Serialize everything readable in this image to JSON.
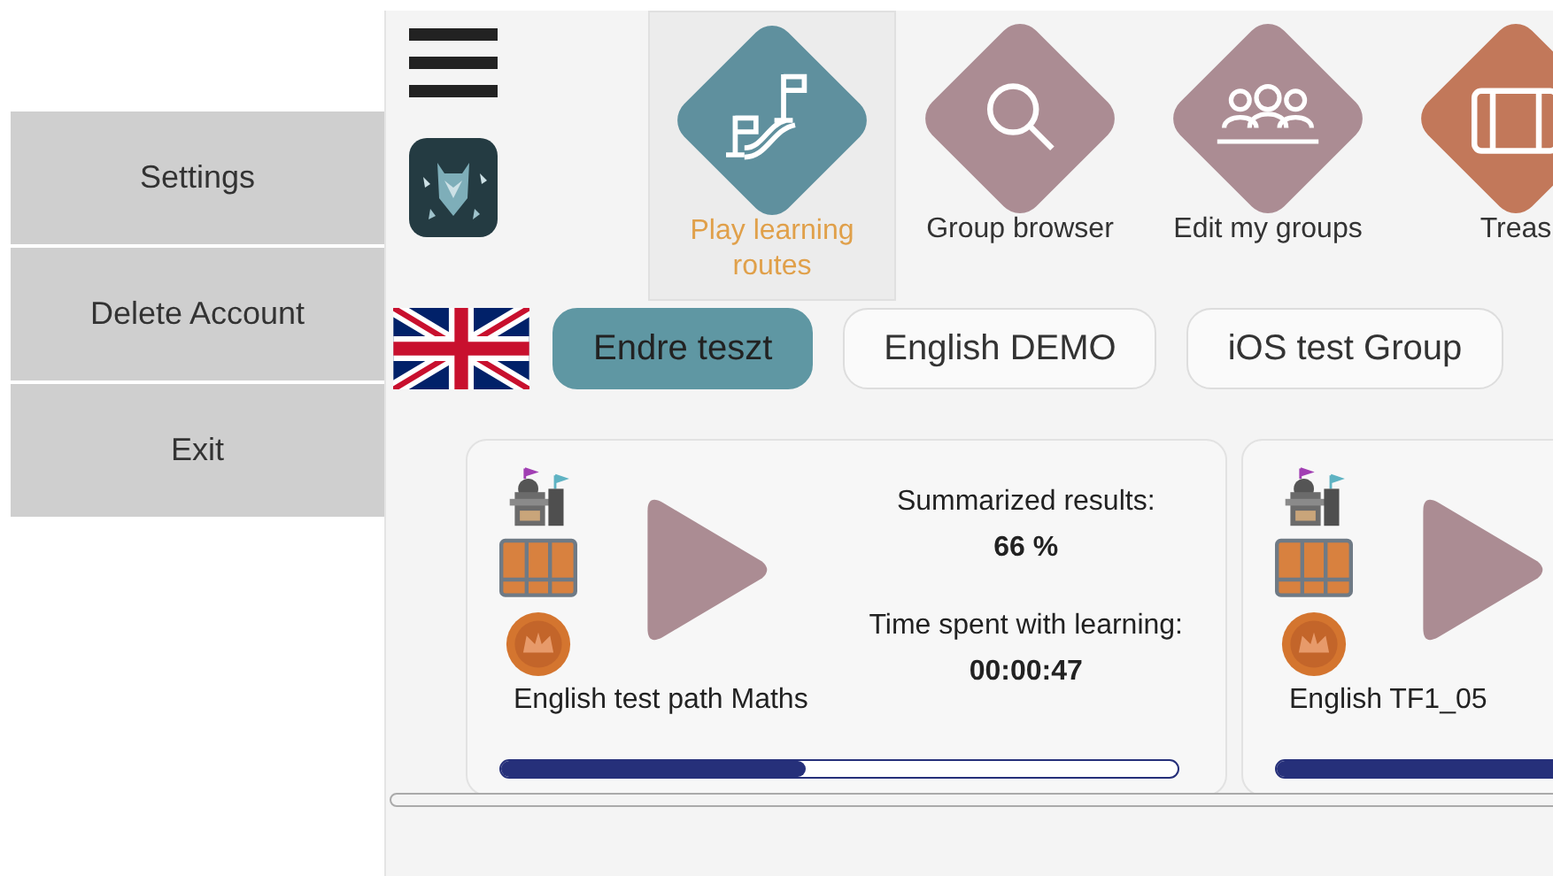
{
  "side_menu": [
    {
      "label": "Settings"
    },
    {
      "label": "Delete Account"
    },
    {
      "label": "Exit"
    }
  ],
  "nav": [
    {
      "label": "Play learning routes",
      "selected": true,
      "color": "#5f909e",
      "kind": "route"
    },
    {
      "label": "Group browser",
      "selected": false,
      "color": "#ab8c93",
      "kind": "search"
    },
    {
      "label": "Edit my groups",
      "selected": false,
      "color": "#ab8c93",
      "kind": "group"
    },
    {
      "label": "Treas",
      "selected": false,
      "color": "#c2785a",
      "kind": "chest"
    }
  ],
  "groups": [
    {
      "label": "Endre teszt",
      "selected": true
    },
    {
      "label": "English DEMO",
      "selected": false
    },
    {
      "label": "iOS test Group",
      "selected": false
    }
  ],
  "routes": [
    {
      "title": "English test path Maths",
      "results_label": "Summarized results:",
      "results": "66 %",
      "time_label": "Time spent with learning:",
      "time": "00:00:47",
      "level": 0.45
    },
    {
      "title": "English TF1_05",
      "level": 1
    }
  ]
}
